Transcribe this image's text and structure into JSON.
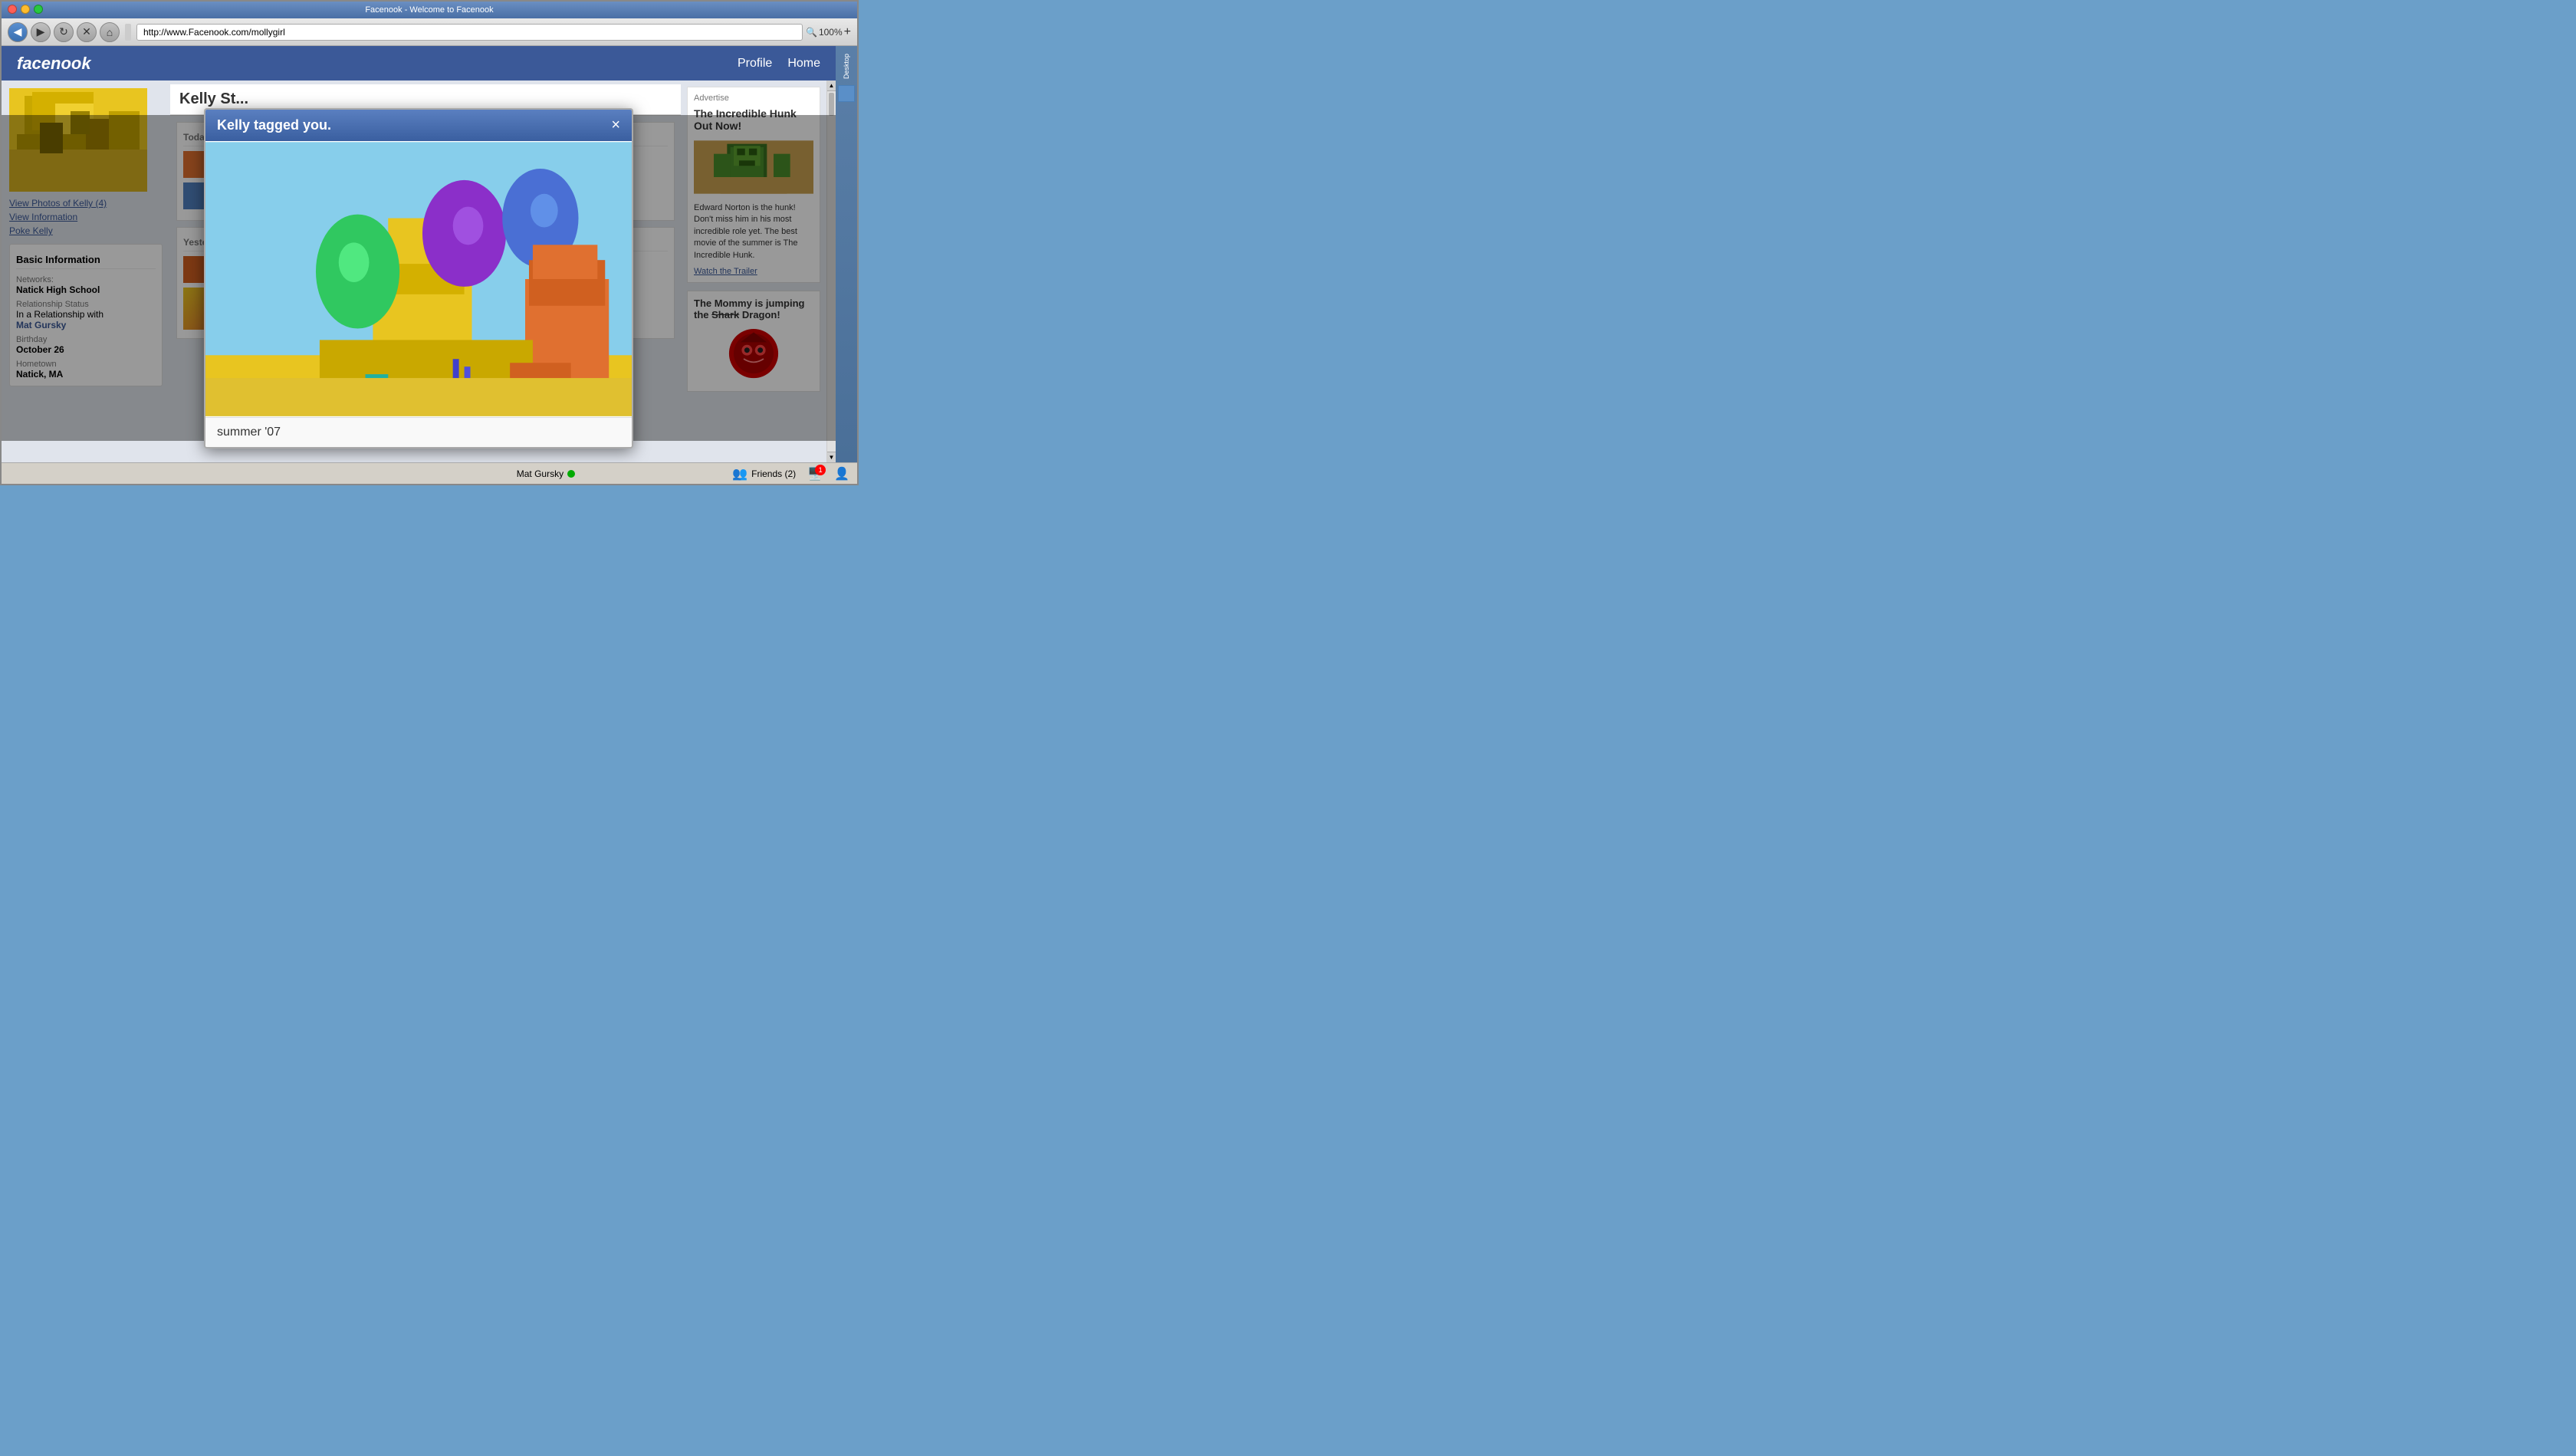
{
  "browser": {
    "title": "Facenook - Welcome to Facenook",
    "url": "http://www.Facenook.com/mollygirl",
    "zoom": "100%",
    "back_btn": "◀",
    "forward_btn": "▶",
    "reload_btn": "↻",
    "stop_btn": "✕",
    "home_btn": "⌂"
  },
  "header": {
    "logo": "facenook",
    "nav_items": [
      "Profile",
      "Home"
    ]
  },
  "sidebar": {
    "photos_link": "View Photos of Kelly (4)",
    "info_link": "View Information",
    "poke_link": "Poke Kelly",
    "basic_info_title": "Basic Information",
    "networks_label": "Networks:",
    "networks_value": "Natick High School",
    "relationship_label": "Relationship Status",
    "relationship_value": "In a Relationship with",
    "relationship_link": "Mat Gursky",
    "birthday_label": "Birthday",
    "birthday_value": "October 26",
    "hometown_label": "Hometown",
    "hometown_value": "Natick, MA"
  },
  "modal": {
    "title": "Kelly tagged you.",
    "close_btn": "×",
    "caption": "summer '07"
  },
  "ads": {
    "advertise_label": "Advertise",
    "ad1_title": "The Incredible Hunk Out Now!",
    "ad1_text": "Edward Norton is the hunk! Don't miss him in his most incredible role yet. The best movie of the summer is The Incredible Hunk.",
    "ad1_link": "Watch the Trailer",
    "ad2_title": "The Mommy is jumping the Shark Dragon!"
  },
  "status_bar": {
    "user": "Mat Gursky",
    "friends_label": "Friends (2)",
    "notification_count": "1"
  },
  "desktop": {
    "label": "Desktop"
  },
  "feed": {
    "today_label": "Today",
    "yesterday_label": "Yesterday"
  },
  "profile": {
    "name": "Kelly St..."
  }
}
